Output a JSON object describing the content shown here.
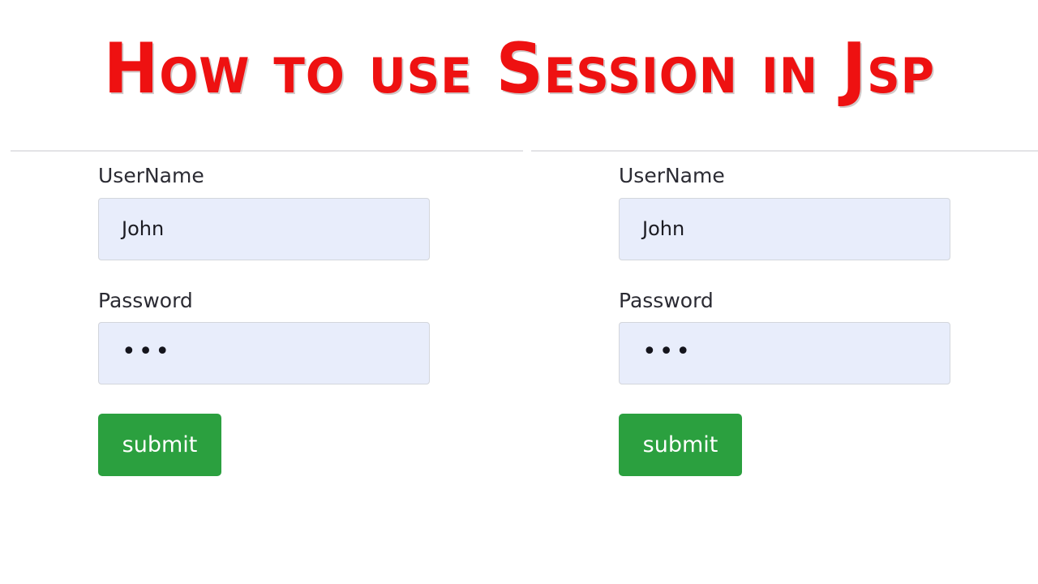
{
  "title": {
    "text": "How to use Session in Jsp",
    "color": "#ee1111"
  },
  "panels": [
    {
      "id": "left",
      "username": {
        "label": "UserName",
        "value": "John",
        "placeholder": ""
      },
      "password": {
        "label": "Password",
        "value": "•••",
        "placeholder": ""
      },
      "submit_label": "submit"
    },
    {
      "id": "right",
      "username": {
        "label": "UserName",
        "value": "John",
        "placeholder": ""
      },
      "password": {
        "label": "Password",
        "value": "•••",
        "placeholder": ""
      },
      "submit_label": "submit"
    }
  ],
  "colors": {
    "title_red": "#ee1111",
    "submit_green": "#2ba03f",
    "input_fill": "#e8edfb",
    "input_border": "#d3d6dc",
    "rule": "#e3e3e6",
    "label_text": "#2b2b33"
  }
}
